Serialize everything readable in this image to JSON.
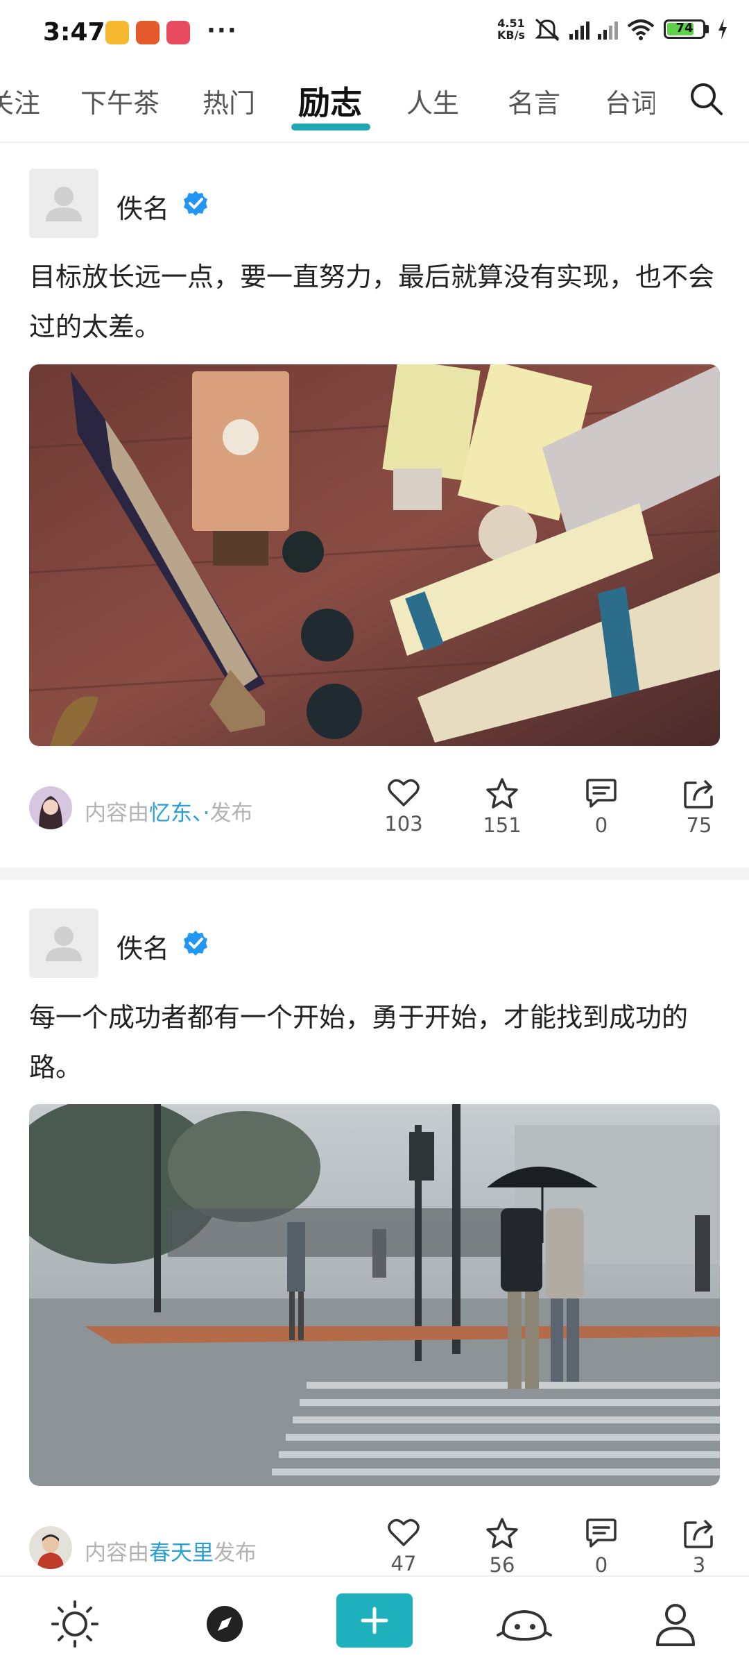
{
  "status_bar": {
    "time": "3:47",
    "more": "···",
    "net_speed_value": "4.51",
    "net_speed_unit": "KB/s",
    "battery": "74"
  },
  "tabs": {
    "items": [
      "关注",
      "下午茶",
      "热门",
      "励志",
      "人生",
      "名言",
      "台词"
    ],
    "active": "励志"
  },
  "posts": [
    {
      "author": "佚名",
      "text": "目标放长远一点，要一直努力，最后就算没有实现，也不会过的太差。",
      "publisher_prefix": "内容由",
      "publisher_name": "忆东、·",
      "publisher_suffix": "发布",
      "likes": "103",
      "favorites": "151",
      "comments": "0",
      "shares": "75"
    },
    {
      "author": "佚名",
      "text": "每一个成功者都有一个开始，勇于开始，才能找到成功的路。",
      "publisher_prefix": "内容由",
      "publisher_name": "春天里",
      "publisher_suffix": "发布",
      "likes": "47",
      "favorites": "56",
      "comments": "0",
      "shares": "3"
    }
  ],
  "colors": {
    "accent": "#1fb0bd",
    "link": "#2a9fd6",
    "verified": "#2196f3"
  }
}
